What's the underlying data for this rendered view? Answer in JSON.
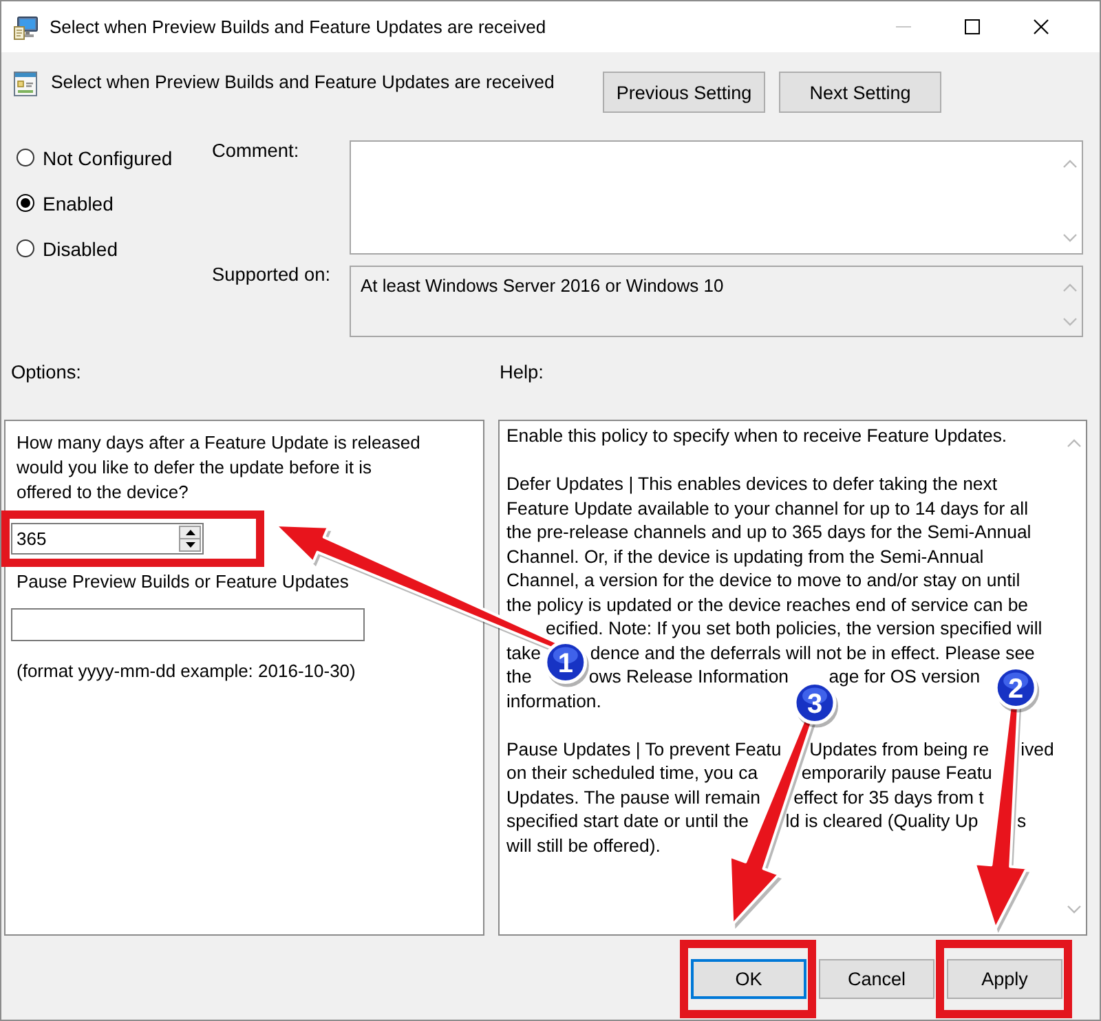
{
  "window": {
    "title": "Select when Preview Builds and Feature Updates are received",
    "controls": [
      {
        "kind": "minimize",
        "disabled": true
      },
      {
        "kind": "maximize",
        "disabled": false
      },
      {
        "kind": "close",
        "disabled": false
      }
    ]
  },
  "header": {
    "title": "Select when Preview Builds and Feature Updates are received",
    "buttons": [
      {
        "label": "Previous Setting"
      },
      {
        "label": "Next Setting"
      }
    ]
  },
  "state": {
    "options": [
      {
        "label": "Not Configured",
        "selected": false
      },
      {
        "label": "Enabled",
        "selected": true
      },
      {
        "label": "Disabled",
        "selected": false
      }
    ]
  },
  "comment": {
    "label": "Comment:"
  },
  "supported_on": {
    "label": "Supported on:",
    "value": "At least Windows Server 2016 or Windows 10"
  },
  "options": {
    "label": "Options:",
    "defer_question": "How many days after a Feature Update is released would you like to defer the update before it is offered to the device?",
    "defer_days": {
      "value": "365",
      "highlighted": true
    },
    "pause_label": "Pause Preview Builds or Feature Updates",
    "pause_hint": "(format yyyy-mm-dd example: 2016-10-30)"
  },
  "help": {
    "label": "Help:",
    "paragraphs": [
      [
        [
          "Enable this policy to specify when to receive Feature Updates."
        ]
      ],
      [
        [
          "Defer Updates | This enables devices to defer taking the next"
        ],
        [
          "Feature Update available to your channel for up to 14 days for all"
        ],
        [
          "the pre-release channels and up to 365 days for the Semi-Annual"
        ],
        [
          "Channel. Or, if the device is updating from the Semi-Annual"
        ],
        [
          "Channel, a version for the device to move to and/or stay on until"
        ],
        [
          "the policy is updated or the device reaches end of service can be"
        ],
        [
          "ecified. Note: If you set both policies, the version specified will"
        ],
        [
          "take",
          "dence and the deferrals will not be in effect. Please see"
        ],
        [
          "the",
          "ows Release Information",
          "age for OS version"
        ],
        [
          "information."
        ]
      ],
      [
        [
          "Pause Updates | To prevent Featu",
          "Updates from being re",
          "ived"
        ],
        [
          "on their scheduled time, you ca",
          "emporarily pause Featu"
        ],
        [
          "Updates. The pause will remain",
          "effect for 35 days from t"
        ],
        [
          "specified start date or until the",
          "ld is cleared (Quality Up",
          "s"
        ],
        [
          "will still be offered)."
        ]
      ]
    ]
  },
  "footer": {
    "buttons": [
      {
        "label": "OK",
        "default": true,
        "highlighted": true
      },
      {
        "label": "Cancel",
        "default": false,
        "highlighted": false
      },
      {
        "label": "Apply",
        "default": false,
        "highlighted": true
      }
    ]
  },
  "annotations": {
    "step_markers": [
      {
        "label": "1"
      },
      {
        "label": "2"
      },
      {
        "label": "3"
      }
    ]
  }
}
